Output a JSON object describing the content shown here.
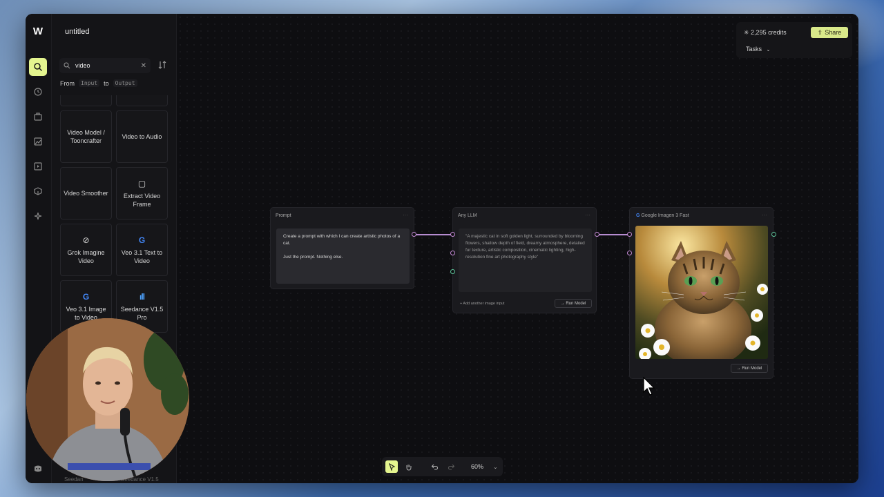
{
  "app": {
    "doc_title": "untitled",
    "logo": "W"
  },
  "rail": {
    "icons": [
      "search-icon",
      "history-icon",
      "briefcase-icon",
      "image-edit-icon",
      "video-icon",
      "cube-icon",
      "sparkle-icon",
      "discord-icon"
    ]
  },
  "sidebar": {
    "search_value": "video",
    "from_label": "From",
    "input_chip": "Input",
    "to_label": "to",
    "output_chip": "Output",
    "cards": [
      {
        "label": "Video Model / Tooncrafter",
        "icon": ""
      },
      {
        "label": "Video to Audio",
        "icon": ""
      },
      {
        "label": "Video Smoother",
        "icon": ""
      },
      {
        "label": "Extract Video Frame",
        "icon": "▢"
      },
      {
        "label": "Grok Imagine Video",
        "icon": "⊘"
      },
      {
        "label": "Veo 3.1 Text to Video",
        "icon": "G"
      },
      {
        "label": "Veo 3.1 Image to Video",
        "icon": "G"
      },
      {
        "label": "Seedance V1.5 Pro",
        "icon": "ıll"
      }
    ],
    "peek_left": "Seedan",
    "peek_right": "Seedance V1.5"
  },
  "header": {
    "credits": "2,295 credits",
    "share_label": "Share",
    "tasks_label": "Tasks"
  },
  "nodes": {
    "prompt": {
      "title": "Prompt",
      "text_line1": "Create a prompt with which I can create artistic photos of a cat.",
      "text_line2": "Just the prompt. Nothing else."
    },
    "llm": {
      "title": "Any LLM",
      "output": "\"A majestic cat in soft golden light, surrounded by blooming flowers, shallow depth of field, dreamy atmosphere, detailed fur texture, artistic composition, cinematic lighting, high-resolution fine art photography style\"",
      "add_image": "+ Add another image input",
      "run_label": "→ Run Model"
    },
    "imagen": {
      "title": "Google Imagen 3 Fast",
      "run_label": "→ Run Model"
    }
  },
  "toolbar": {
    "zoom": "60%"
  },
  "colors": {
    "accent": "#e4f58f",
    "wire": "#b68cd0",
    "handle_green": "#5ec49a",
    "bg": "#0f0f12"
  }
}
